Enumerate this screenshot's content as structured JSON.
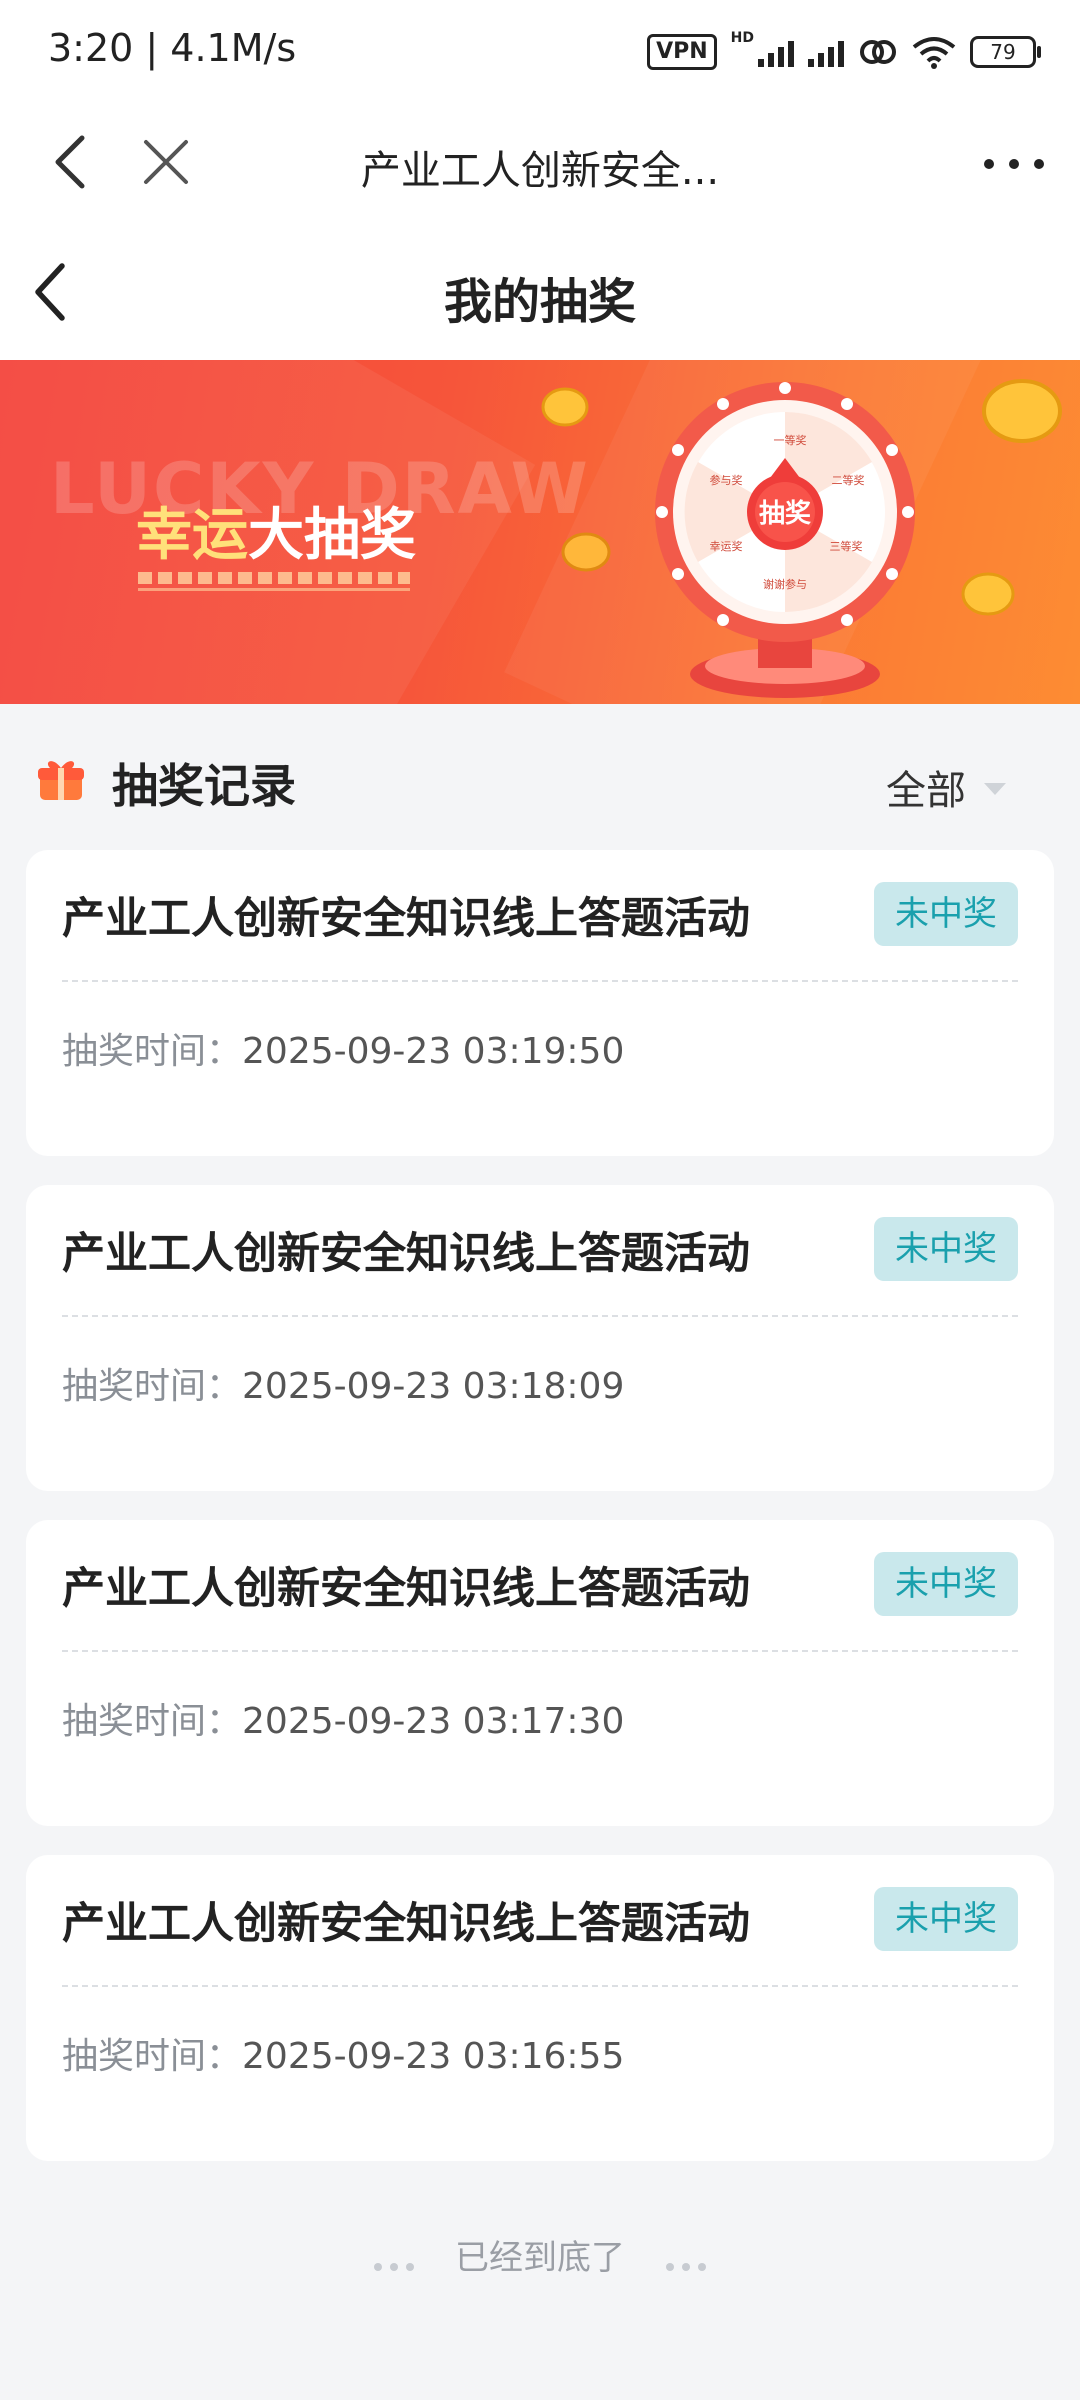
{
  "status_bar": {
    "time_speed": "3:20 | 4.1M/s",
    "vpn": "VPN",
    "hd": "HD",
    "battery": "79"
  },
  "browser": {
    "title": "产业工人创新安全..."
  },
  "header": {
    "title": "我的抽奖"
  },
  "banner": {
    "bg_text": "LUCKY DRAW",
    "title_highlight": "幸运",
    "title_rest": "大抽奖",
    "wheel_center": "抽奖",
    "wheel_prizes": [
      "一等奖",
      "二等奖",
      "三等奖",
      "谢谢参与",
      "幸运奖",
      "参与奖"
    ]
  },
  "section": {
    "title": "抽奖记录",
    "filter": "全部"
  },
  "records": [
    {
      "title": "产业工人创新安全知识线上答题活动",
      "status": "未中奖",
      "time_label": "抽奖时间：",
      "time": "2025-09-23 03:19:50"
    },
    {
      "title": "产业工人创新安全知识线上答题活动",
      "status": "未中奖",
      "time_label": "抽奖时间：",
      "time": "2025-09-23 03:18:09"
    },
    {
      "title": "产业工人创新安全知识线上答题活动",
      "status": "未中奖",
      "time_label": "抽奖时间：",
      "time": "2025-09-23 03:17:30"
    },
    {
      "title": "产业工人创新安全知识线上答题活动",
      "status": "未中奖",
      "time_label": "抽奖时间：",
      "time": "2025-09-23 03:16:55"
    }
  ],
  "footer": {
    "text": "已经到底了"
  },
  "colors": {
    "accent": "#f4433b",
    "badge_bg": "#c9e8ec",
    "badge_text": "#1aa0ad"
  }
}
